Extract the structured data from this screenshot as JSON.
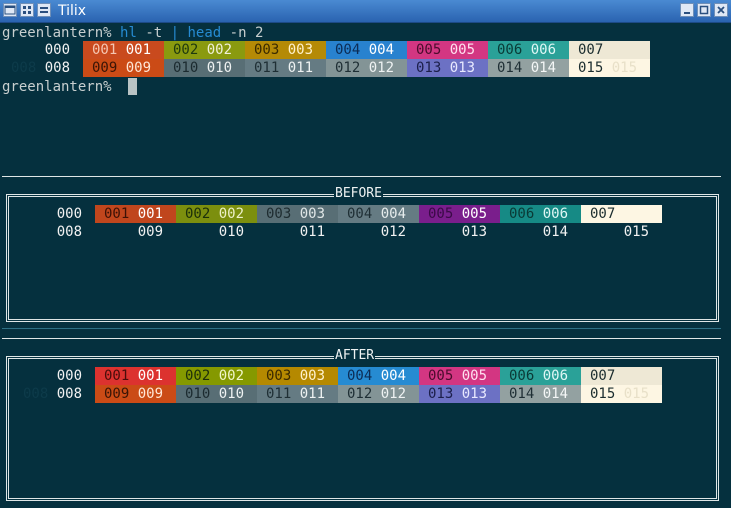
{
  "window": {
    "title": "Tilix"
  },
  "prompt": {
    "user": "greenlantern",
    "symbol": "%"
  },
  "command": {
    "cmd": "hl",
    "flag": "-t",
    "pipe": "|",
    "cmd2": "head",
    "args": "-n 2"
  },
  "sections": {
    "before": "BEFORE",
    "after": "AFTER"
  },
  "top_rows": [
    [
      {
        "label": "000",
        "bg": "#05303e",
        "a": "",
        "fg": "#f2f2f2"
      },
      {
        "label": "001",
        "bg": "#c94a1e",
        "a": "#f5c6b2",
        "fg": "#ffffff"
      },
      {
        "label": "002",
        "bg": "#8a9a0f",
        "a": "#1f3a0e",
        "fg": "#f0f0d8"
      },
      {
        "label": "003",
        "bg": "#b58a06",
        "a": "#3a2a00",
        "fg": "#fff2cc"
      },
      {
        "label": "004",
        "bg": "#2882cf",
        "a": "#0c2c55",
        "fg": "#ffffff"
      },
      {
        "label": "005",
        "bg": "#d33682",
        "a": "#4a0c2c",
        "fg": "#ffe0ef"
      },
      {
        "label": "006",
        "bg": "#2aa198",
        "a": "#0a3a36",
        "fg": "#dff7f5"
      },
      {
        "label": "007",
        "bg": "#eee8d5",
        "a": "#1b2d2f",
        "fg": ""
      }
    ],
    [
      {
        "label": "008",
        "bg": "#05303e",
        "a": "#0d3b4a",
        "fg": "#f2f2f2"
      },
      {
        "label": "009",
        "bg": "#cb4b16",
        "a": "#3a1506",
        "fg": "#ffe6d6"
      },
      {
        "label": "010",
        "bg": "#586e75",
        "a": "#1c2b30",
        "fg": "#eef2f2"
      },
      {
        "label": "011",
        "bg": "#657b83",
        "a": "#1f2f35",
        "fg": "#eef2f2"
      },
      {
        "label": "012",
        "bg": "#839496",
        "a": "#1f2f35",
        "fg": "#eef2f2"
      },
      {
        "label": "013",
        "bg": "#6c71c4",
        "a": "#1c1f4a",
        "fg": "#e8e9ff"
      },
      {
        "label": "014",
        "bg": "#93a1a1",
        "a": "#1f2f35",
        "fg": "#f4f7f7"
      },
      {
        "label": "015",
        "bg": "#fdf6e3",
        "a": "#1b2d2f",
        "fg": "#e8e0c8"
      }
    ]
  ],
  "before_rows": [
    [
      {
        "label": "000",
        "bg": "#05303e",
        "a": "",
        "fg": "#f2f2f2"
      },
      {
        "label": "001",
        "bg": "#c0461d",
        "a": "#3d1206",
        "fg": "#ffffff"
      },
      {
        "label": "002",
        "bg": "#7c8f0e",
        "a": "#1c300a",
        "fg": "#ecf0c8"
      },
      {
        "label": "003",
        "bg": "#586e75",
        "a": "#1e2c30",
        "fg": "#dfe6e6"
      },
      {
        "label": "004",
        "bg": "#657b83",
        "a": "#1f2f35",
        "fg": "#e6ecec"
      },
      {
        "label": "005",
        "bg": "#7a1e8c",
        "a": "#3a0a46",
        "fg": "#ffffff"
      },
      {
        "label": "006",
        "bg": "#168a85",
        "a": "#0a3a36",
        "fg": "#dff7f5"
      },
      {
        "label": "007",
        "bg": "#fdf6e3",
        "a": "#1b2d2f",
        "fg": ""
      }
    ],
    [
      {
        "label": "008",
        "bg": "#05303e",
        "a": "",
        "fg": "#f2f2f2"
      },
      {
        "label": "009",
        "bg": "#05303e",
        "a": "",
        "fg": "#f2f2f2"
      },
      {
        "label": "010",
        "bg": "#05303e",
        "a": "",
        "fg": "#f2f2f2"
      },
      {
        "label": "011",
        "bg": "#05303e",
        "a": "",
        "fg": "#f2f2f2"
      },
      {
        "label": "012",
        "bg": "#05303e",
        "a": "",
        "fg": "#f2f2f2"
      },
      {
        "label": "013",
        "bg": "#05303e",
        "a": "",
        "fg": "#f2f2f2"
      },
      {
        "label": "014",
        "bg": "#05303e",
        "a": "",
        "fg": "#f2f2f2"
      },
      {
        "label": "015",
        "bg": "#05303e",
        "a": "",
        "fg": "#f2f2f2"
      }
    ]
  ],
  "after_rows": [
    [
      {
        "label": "000",
        "bg": "#05303e",
        "a": "",
        "fg": "#f2f2f2"
      },
      {
        "label": "001",
        "bg": "#dc322f",
        "a": "#4a0d0b",
        "fg": "#ffffff"
      },
      {
        "label": "002",
        "bg": "#859900",
        "a": "#1f300a",
        "fg": "#f0f6c8"
      },
      {
        "label": "003",
        "bg": "#b58900",
        "a": "#3a2a00",
        "fg": "#fff2cc"
      },
      {
        "label": "004",
        "bg": "#268bd2",
        "a": "#0c2c55",
        "fg": "#ffffff"
      },
      {
        "label": "005",
        "bg": "#d33682",
        "a": "#4a0c2c",
        "fg": "#ffe0ef"
      },
      {
        "label": "006",
        "bg": "#2aa198",
        "a": "#0a3a36",
        "fg": "#dff7f5"
      },
      {
        "label": "007",
        "bg": "#eee8d5",
        "a": "#1b2d2f",
        "fg": ""
      }
    ],
    [
      {
        "label": "008",
        "bg": "#05303e",
        "a": "#0d3b4a",
        "fg": "#f2f2f2"
      },
      {
        "label": "009",
        "bg": "#cb4b16",
        "a": "#3a1506",
        "fg": "#ffe6d6"
      },
      {
        "label": "010",
        "bg": "#586e75",
        "a": "#1c2b30",
        "fg": "#eef2f2"
      },
      {
        "label": "011",
        "bg": "#657b83",
        "a": "#1f2f35",
        "fg": "#eef2f2"
      },
      {
        "label": "012",
        "bg": "#839496",
        "a": "#1f2f35",
        "fg": "#eef2f2"
      },
      {
        "label": "013",
        "bg": "#6c71c4",
        "a": "#1c1f4a",
        "fg": "#e8e9ff"
      },
      {
        "label": "014",
        "bg": "#93a1a1",
        "a": "#1f2f35",
        "fg": "#f4f7f7"
      },
      {
        "label": "015",
        "bg": "#fdf6e3",
        "a": "#1b2d2f",
        "fg": "#e8e0c8"
      }
    ]
  ]
}
